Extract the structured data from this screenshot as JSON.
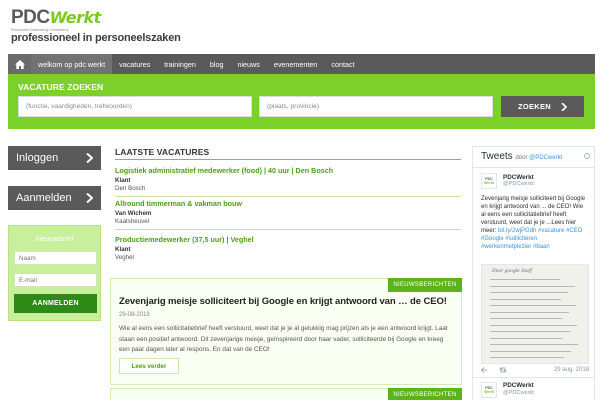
{
  "header": {
    "brand_primary": "PDC",
    "brand_secondary": "Werkt",
    "brand_small": "Personeels Detachering Consultancy",
    "tagline": "professioneel in personeelszaken"
  },
  "nav": {
    "home_icon": "home-icon",
    "items": [
      {
        "label": "welkom op pdc werkt",
        "active": true
      },
      {
        "label": "vacatures"
      },
      {
        "label": "trainingen"
      },
      {
        "label": "blog"
      },
      {
        "label": "nieuws"
      },
      {
        "label": "evenementen"
      },
      {
        "label": "contact"
      }
    ]
  },
  "search": {
    "title": "VACATURE ZOEKEN",
    "field1_placeholder": "(functie, vaardigheden, trefwoorden)",
    "field2_placeholder": "(plaats, provincie)",
    "button_label": "ZOEKEN",
    "button_icon": "chevron-right-icon"
  },
  "sidebar": {
    "login_label": "Inloggen",
    "register_label": "Aanmelden",
    "newsletter": {
      "title": "nieuwsbrief",
      "name_placeholder": "Naam",
      "email_placeholder": "E-mail",
      "button_label": "AANMELDEN"
    }
  },
  "vacatures": {
    "title": "LAATSTE VACATURES",
    "items": [
      {
        "title": "Logistiek administratief medewerker (food) | 40 uur | Den Bosch",
        "company": "Klant",
        "location": "Den Bosch"
      },
      {
        "title": "Allround timmerman & vakman bouw",
        "company": "Van Wichem",
        "location": "Kaatsheuvel"
      },
      {
        "title": "Productiemedewerker (37,5 uur) | Veghel",
        "company": "Klant",
        "location": "Veghel"
      }
    ]
  },
  "news": {
    "badge": "NIEUWSBERICHTEN",
    "title": "Zevenjarig meisje solliciteert bij Google en krijgt antwoord van … de CEO!",
    "date": "29-08-2018",
    "body": "Wie al eens een sollicitatiebrief heeft verstuurd, weet dat je je al gelukkig mag prijzen als je een antwoord krijgt. Laat staan een positief antwoord. Dit zevenjarige meisje, geïnspireerd door haar vader, solliciteerde bij Google en kreeg een paar dagen later al respons. En dat van de CEO!",
    "read_more": "Lees verder",
    "badge2": "NIEUWSBERICHTEN"
  },
  "twitter": {
    "title": "Tweets",
    "by": "door",
    "handle": "@PDCwerkt",
    "info_icon": "info-icon",
    "tweets": [
      {
        "name": "PDCWerkt",
        "handle": "@PDCwerkt",
        "text": "Zevenjarig meisje solliciteert bij Google en krijgt antwoord van ... de CEO! Wie al eens een sollicitatiebrief heeft verstuurd, weet dat je je ...Lees hier meer: ",
        "link": "bit.ly/2wjPGdh",
        "hashtags": "#vacature #CEO #Google #solliciteren #werkenmetplezier #baan",
        "date": "29 aug. 2018"
      },
      {
        "name": "PDCWerkt",
        "handle": "@PDCwerkt"
      }
    ],
    "image_caption": "Dear google Staff"
  },
  "colors": {
    "accent_green": "#7cd02a",
    "dark_gray": "#5a5a5a",
    "link_green": "#4e9e16",
    "twitter_blue": "#3b94d9"
  }
}
